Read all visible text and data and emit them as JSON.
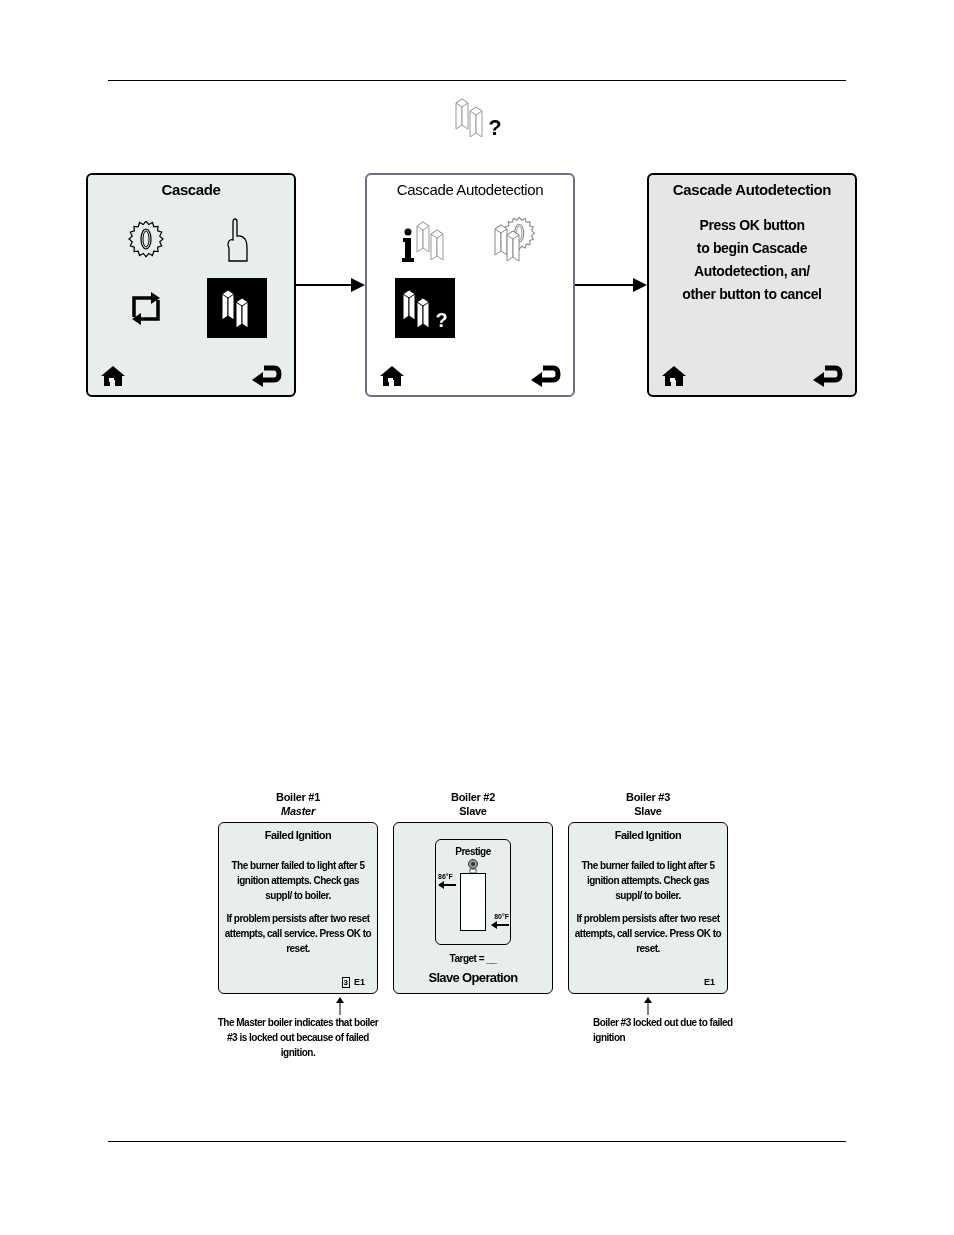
{
  "header_icon": {
    "label": "?"
  },
  "flow": [
    {
      "kind": "menu",
      "title": "Cascade",
      "title_bold": true,
      "color": "#e8eeee",
      "items": [
        {
          "kind": "gear",
          "selected": false
        },
        {
          "kind": "hand",
          "selected": false
        },
        {
          "kind": "cycle",
          "selected": false
        },
        {
          "kind": "boilers",
          "selected": true
        }
      ]
    },
    {
      "kind": "menu",
      "title": "Cascade Autodetection",
      "title_bold": false,
      "color": "#ffffff",
      "items": [
        {
          "kind": "info",
          "selected": false
        },
        {
          "kind": "boilers-gear",
          "selected": false
        },
        {
          "kind": "boilers",
          "label": "?",
          "selected": true
        }
      ]
    },
    {
      "kind": "message",
      "title": "Cascade Autodetection",
      "title_bold": true,
      "color": "#e6e6e6",
      "lines": [
        "Press OK button",
        "to begin Cascade",
        "Autodetection, an/",
        "other button to cancel"
      ]
    }
  ],
  "boilers": [
    {
      "kind": "fault",
      "name": "Boiler #1",
      "role": "Master",
      "role_italic": true,
      "title": "Failed Ignition",
      "paragraphs": [
        "The burner failed to light after 5 ignition attempts. Check gas suppl/  to boiler.",
        "If problem persists after two reset attempts, call service. Press OK to reset."
      ],
      "badge": "3",
      "code": "E1",
      "note": "The Master boiler indicates that boiler #3 is locked out because of failed ignition."
    },
    {
      "kind": "status",
      "name": "Boiler #2",
      "role": "Slave",
      "role_italic": false,
      "title": "Prestige",
      "outlet": "86°F",
      "inlet": "80°F",
      "target": "Target = __",
      "footer": "Slave Operation"
    },
    {
      "kind": "fault",
      "name": "Boiler #3",
      "role": "Slave",
      "role_italic": false,
      "title": "Failed Ignition",
      "paragraphs": [
        "The burner failed to light after 5 ignition attempts. Check gas suppl/  to boiler.",
        "If problem persists after two reset attempts, call service. Press OK to reset."
      ],
      "code": "E1",
      "note": "Boiler #3 locked out due to failed ignition"
    }
  ]
}
